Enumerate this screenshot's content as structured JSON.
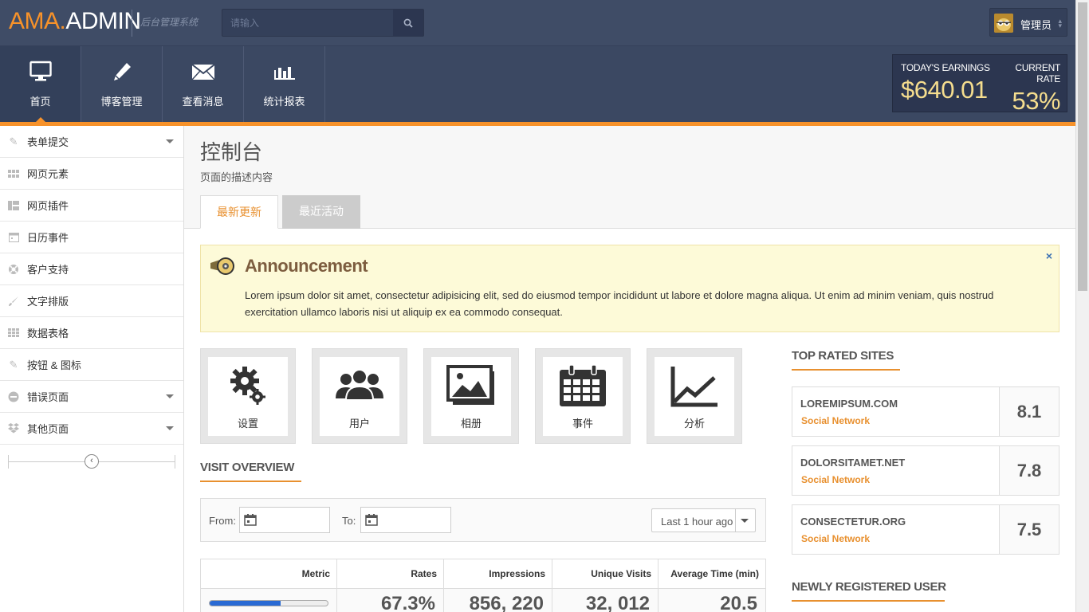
{
  "header": {
    "logo_a": "AMA.",
    "logo_b": "ADMIN",
    "subtitle": "后台管理系统",
    "search_placeholder": "请输入",
    "user_name": "管理员"
  },
  "nav": [
    {
      "label": "首页",
      "icon": "monitor-icon"
    },
    {
      "label": "博客管理",
      "icon": "pencil-icon"
    },
    {
      "label": "查看消息",
      "icon": "envelope-icon"
    },
    {
      "label": "统计报表",
      "icon": "bar-chart-icon"
    }
  ],
  "stats": {
    "earnings_label": "TODAY'S EARNINGS",
    "earnings_value": "$640.01",
    "rate_label": "CURRENT RATE",
    "rate_value": "53%"
  },
  "sidebar": {
    "items": [
      {
        "label": "表单提交",
        "icon": "pencil-icon",
        "has_arrow": true
      },
      {
        "label": "网页元素",
        "icon": "grid-icon",
        "has_arrow": false
      },
      {
        "label": "网页插件",
        "icon": "layout-icon",
        "has_arrow": false
      },
      {
        "label": "日历事件",
        "icon": "calendar-icon",
        "has_arrow": false
      },
      {
        "label": "客户支持",
        "icon": "lifebuoy-icon",
        "has_arrow": false
      },
      {
        "label": "文字排版",
        "icon": "brush-icon",
        "has_arrow": false
      },
      {
        "label": "数据表格",
        "icon": "table-icon",
        "has_arrow": false
      },
      {
        "label": "按钮 & 图标",
        "icon": "pencil-icon",
        "has_arrow": false
      },
      {
        "label": "错误页面",
        "icon": "minus-circle-icon",
        "has_arrow": true
      },
      {
        "label": "其他页面",
        "icon": "dropbox-icon",
        "has_arrow": true
      }
    ]
  },
  "page": {
    "title": "控制台",
    "description": "页面的描述内容",
    "tabs": [
      "最新更新",
      "最近活动"
    ]
  },
  "announcement": {
    "title": "Announcement",
    "text": "Lorem ipsum dolor sit amet, consectetur adipisicing elit, sed do eiusmod tempor incididunt ut labore et dolore magna aliqua. Ut enim ad minim veniam, quis nostrud exercitation ullamco laboris nisi ut aliquip ex ea commodo consequat.",
    "close": "×"
  },
  "shortcuts": [
    {
      "label": "设置",
      "icon": "gears-icon"
    },
    {
      "label": "用户",
      "icon": "users-icon"
    },
    {
      "label": "相册",
      "icon": "pictures-icon"
    },
    {
      "label": "事件",
      "icon": "calendar-icon"
    },
    {
      "label": "分析",
      "icon": "line-chart-icon"
    }
  ],
  "visit_overview": {
    "title": "VISIT OVERVIEW",
    "from_label": "From:",
    "to_label": "To:",
    "range_value": "Last 1 hour ago",
    "columns": [
      "Metric",
      "Rates",
      "Impressions",
      "Unique Visits",
      "Average Time (min)"
    ],
    "row": {
      "progress": 0.6,
      "rates": "67.3%",
      "impressions": "856, 220",
      "unique": "32, 012",
      "avg": "20.5"
    }
  },
  "top_rated": {
    "title": "TOP RATED SITES",
    "sites": [
      {
        "name": "LOREMIPSUM.COM",
        "category": "Social Network",
        "score": "8.1"
      },
      {
        "name": "DOLORSITAMET.NET",
        "category": "Social Network",
        "score": "7.8"
      },
      {
        "name": "CONSECTETUR.ORG",
        "category": "Social Network",
        "score": "7.5"
      }
    ]
  },
  "new_users": {
    "title": "NEWLY REGISTERED USER"
  },
  "colors": {
    "accent": "#f7922a",
    "header": "#3f4c66",
    "earnings": "#f5dd8e",
    "progress": "#2a6ad3"
  }
}
